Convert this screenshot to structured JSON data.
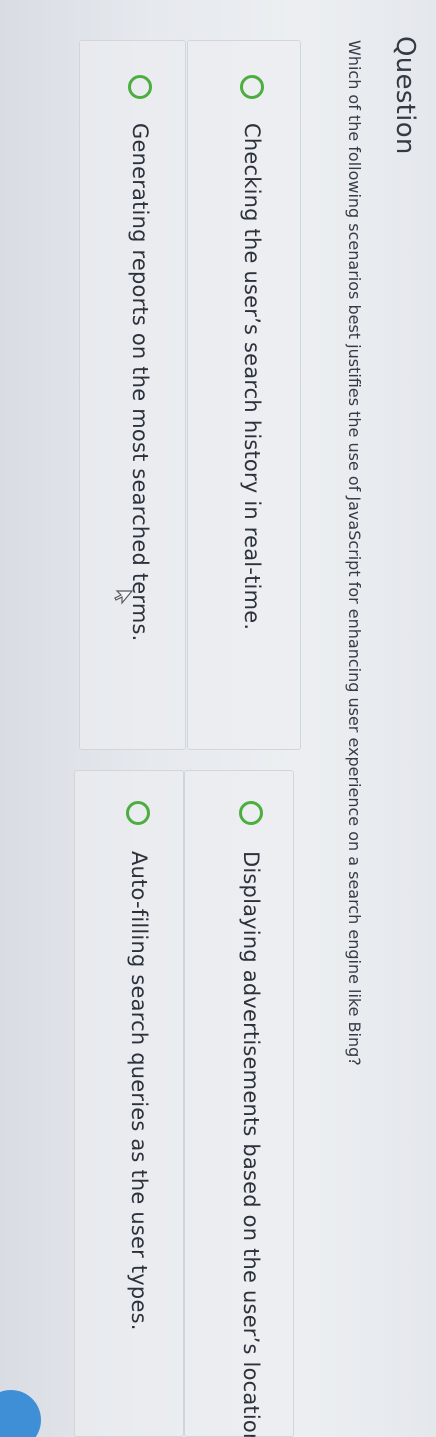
{
  "question": {
    "title": "Question",
    "text": "Which of the following scenarios best justifies the use of JavaScript for enhancing user experience on a search engine like Bing?"
  },
  "options": [
    {
      "label": "Checking the user’s search history in real-time."
    },
    {
      "label": "Generating reports on the most searched terms."
    },
    {
      "label": "Displaying advertisements based on the user’s location."
    },
    {
      "label": "Auto-filling search queries as the user types."
    }
  ],
  "colors": {
    "radio_outline": "#4cae3f",
    "accent_dot": "#3f8fd6"
  },
  "icons": {
    "radio": "radio-unselected-icon",
    "cursor": "mouse-pointer-icon"
  }
}
